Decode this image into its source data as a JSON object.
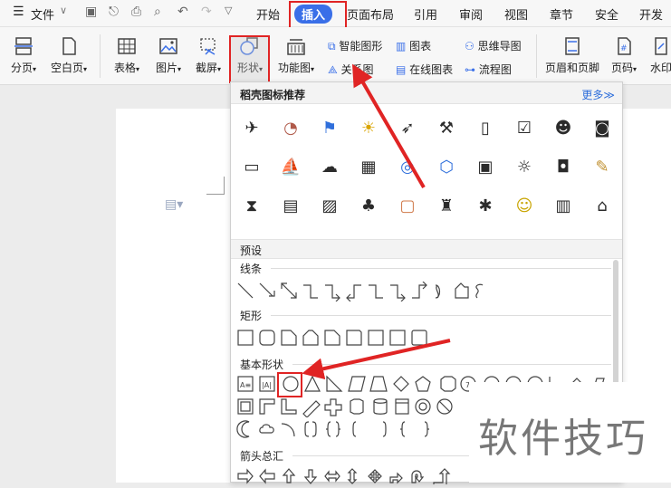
{
  "menubar": {
    "file_label": "文件",
    "tabs": [
      "开始",
      "插入",
      "页面布局",
      "引用",
      "审阅",
      "视图",
      "章节",
      "安全",
      "开发工"
    ],
    "active_tab": "插入"
  },
  "ribbon": {
    "page_break": "分页",
    "blank_page": "空白页",
    "table": "表格",
    "picture": "图片",
    "screenshot": "截屏",
    "shape": "形状",
    "function_chart": "功能图",
    "smart_graphic": "智能图形",
    "chart": "图表",
    "mind_map": "思维导图",
    "relation_chart": "关系图",
    "online_chart": "在线图表",
    "flowchart": "流程图",
    "header_footer": "页眉和页脚",
    "page_number": "页码",
    "watermark": "水印"
  },
  "popup": {
    "title": "稻壳图标推荐",
    "more": "更多≫",
    "presets_title": "预设",
    "sections": {
      "lines": "线条",
      "rectangles": "矩形",
      "basic_shapes": "基本形状",
      "arrows": "箭头总汇"
    },
    "icons": [
      "airplane-icon",
      "pie-chart-icon",
      "flag-icon",
      "lightbulb-icon",
      "rocket-icon",
      "anvil-icon",
      "notebook-icon",
      "checklist-icon",
      "users-icon",
      "camera-icon",
      "wallet-icon",
      "boat-icon",
      "cloud-sun-icon",
      "building-icon",
      "target-icon",
      "hexagon-icon",
      "contact-card-icon",
      "sun-icon",
      "shopping-bag-icon",
      "edit-note-icon",
      "hourglass-icon",
      "sale-sign-icon",
      "presentation-icon",
      "tree-icon",
      "search-doc-icon",
      "trash-bin-icon",
      "crab-icon",
      "worker-icon",
      "calendar-icon",
      "house-icon"
    ]
  },
  "watermark_text": "软件技巧"
}
